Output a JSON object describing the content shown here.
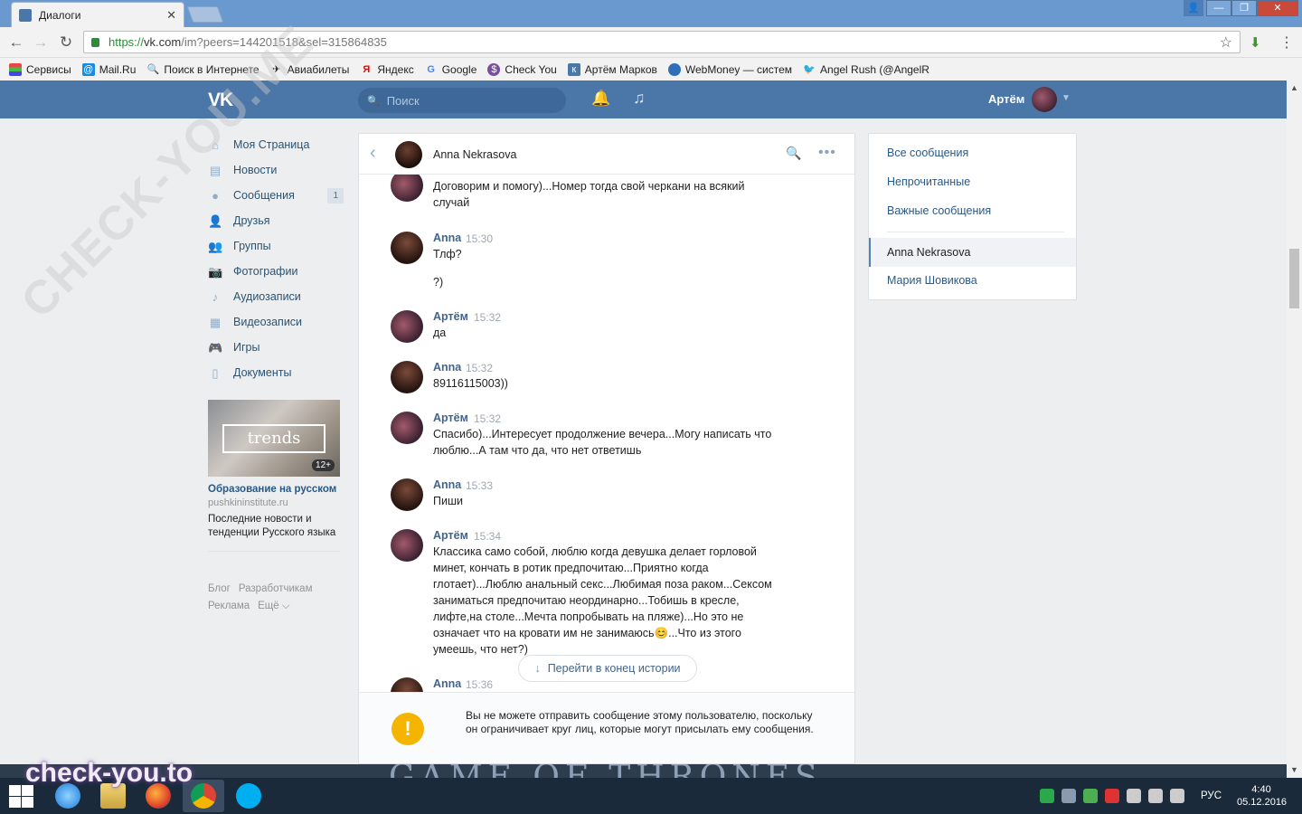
{
  "browser": {
    "tab_title": "Диалоги",
    "url_proto": "https://",
    "url_host": "vk.com",
    "url_path": "/im?peers=144201518&sel=315864835",
    "bookmarks": [
      "Сервисы",
      "Mail.Ru",
      "Поиск в Интернете",
      "Авиабилеты",
      "Яндекс",
      "Google",
      "Check You",
      "Артём Марков",
      "WebMoney — систем",
      "Angel Rush (@AngelR"
    ]
  },
  "header": {
    "logo": "VK",
    "search_placeholder": "Поиск",
    "user_name": "Артём"
  },
  "left_menu": {
    "items": [
      {
        "label": "Моя Страница",
        "icon": "home-icon"
      },
      {
        "label": "Новости",
        "icon": "news-icon"
      },
      {
        "label": "Сообщения",
        "icon": "messages-icon",
        "badge": "1"
      },
      {
        "label": "Друзья",
        "icon": "friends-icon"
      },
      {
        "label": "Группы",
        "icon": "groups-icon"
      },
      {
        "label": "Фотографии",
        "icon": "photo-icon"
      },
      {
        "label": "Аудиозаписи",
        "icon": "audio-icon"
      },
      {
        "label": "Видеозаписи",
        "icon": "video-icon"
      },
      {
        "label": "Игры",
        "icon": "games-icon"
      },
      {
        "label": "Документы",
        "icon": "documents-icon"
      }
    ]
  },
  "ad": {
    "image_text": "trends",
    "age": "12+",
    "title": "Образование на русском",
    "domain": "pushkininstitute.ru",
    "description": "Последние новости и тенденции Русского языка"
  },
  "footer_links": [
    "Блог",
    "Разработчикам",
    "Реклама",
    "Ещё ⌵"
  ],
  "chat": {
    "peer_name": "Anna Nekrasova",
    "messages": [
      {
        "author": "",
        "time": "",
        "text": "Договорим и помогу)...Номер тогда свой черкани на всякий случай"
      },
      {
        "author": "Anna",
        "time": "15:30",
        "text": "Тлф?"
      },
      {
        "author": "",
        "time": "",
        "text": "?)"
      },
      {
        "author": "Артём",
        "time": "15:32",
        "text": "да"
      },
      {
        "author": "Anna",
        "time": "15:32",
        "text": "89116115003))"
      },
      {
        "author": "Артём",
        "time": "15:32",
        "text": "Спасибо)...Интересует продолжение вечера...Могу написать что люблю...А там что да, что нет ответишь"
      },
      {
        "author": "Anna",
        "time": "15:33",
        "text": "Пиши"
      },
      {
        "author": "Артём",
        "time": "15:34",
        "text": "Классика само собой, люблю когда девушка делает горловой минет, кончать в ротик предпочитаю...Приятно когда глотает)...Люблю анальный секс...Любимая поза раком...Сексом заниматься предпочитаю неординарно...Тобишь в кресле, лифте,на столе...Мечта попробывать на пляже)...Но это не означает что на кровати им не занимаюсь😊...Что из этого умеешь, что нет?)"
      },
      {
        "author": "Anna",
        "time": "15:36",
        "text": ""
      }
    ],
    "goto_end": "Перейти в конец истории",
    "warning": "Вы не можете отправить сообщение этому пользователю, поскольку он ограничивает круг лиц, которые могут присылать ему сообщения."
  },
  "right_panel": {
    "filters": [
      "Все сообщения",
      "Непрочитанные",
      "Важные сообщения"
    ],
    "dialogs": [
      {
        "name": "Anna Nekrasova",
        "active": true
      },
      {
        "name": "Мария Шовикова",
        "active": false
      }
    ]
  },
  "watermarks": {
    "diagonal": "CHECK-YOU.ME",
    "bottom": "check-you.to"
  },
  "desktop_banner": "GAME OF THRONES",
  "taskbar": {
    "language": "РУС",
    "time": "4:40",
    "date": "05.12.2016"
  }
}
